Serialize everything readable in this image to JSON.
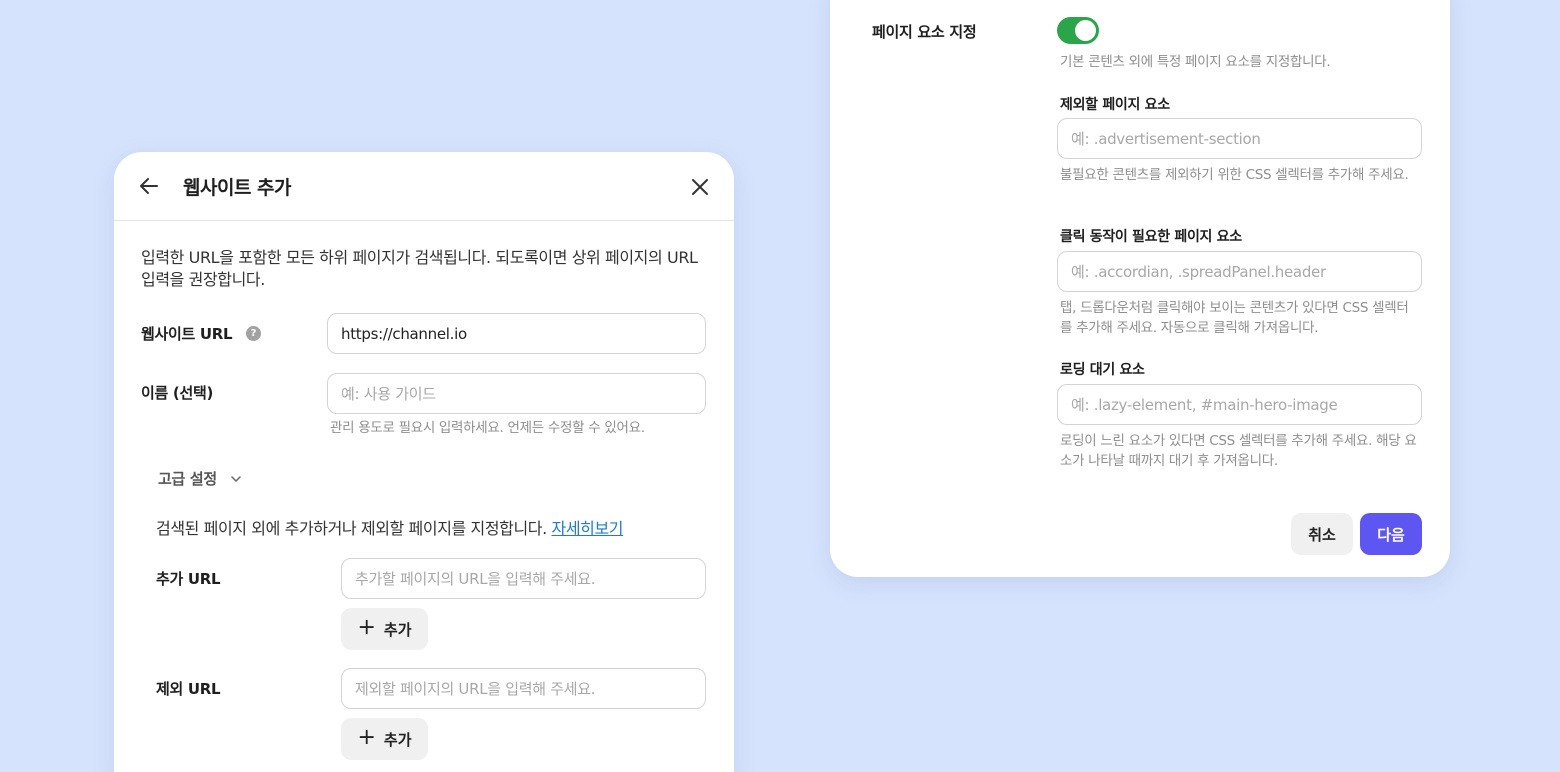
{
  "left": {
    "title": "웹사이트 추가",
    "description": "입력한 URL을 포함한 모든 하위 페이지가 검색됩니다. 되도록이면 상위 페이지의 URL 입력을 권장합니다.",
    "url_label": "웹사이트 URL",
    "help_glyph": "?",
    "url_value": "https://channel.io",
    "name_label": "이름 (선택)",
    "name_placeholder": "예: 사용 가이드",
    "name_hint": "관리 용도로 필요시 입력하세요. 언제든 수정할 수 있어요.",
    "advanced_label": "고급 설정",
    "advanced_desc": "검색된 페이지 외에 추가하거나 제외할 페이지를 지정합니다. ",
    "learn_more": "자세히보기",
    "add_url_label": "추가 URL",
    "add_url_placeholder": "추가할 페이지의 URL을 입력해 주세요.",
    "add_button": "추가",
    "exclude_url_label": "제외 URL",
    "exclude_url_placeholder": "제외할 페이지의 URL을 입력해 주세요.",
    "exclude_add_button": "추가"
  },
  "right": {
    "element_label": "페이지 요소 지정",
    "toggle_on": true,
    "toggle_desc": "기본 콘텐츠 외에 특정 페이지 요소를 지정합니다.",
    "exclude_title": "제외할 페이지 요소",
    "exclude_placeholder": "예: .advertisement-section",
    "exclude_hint": "불필요한 콘텐츠를 제외하기 위한 CSS 셀렉터를 추가해 주세요.",
    "click_title": "클릭 동작이 필요한 페이지 요소",
    "click_placeholder": "예: .accordian, .spreadPanel.header",
    "click_hint": "탭, 드롭다운처럼 클릭해야 보이는 콘텐츠가 있다면 CSS 셀렉터를 추가해 주세요. 자동으로 클릭해 가져옵니다.",
    "loading_title": "로딩 대기 요소",
    "loading_placeholder": "예: .lazy-element, #main-hero-image",
    "loading_hint": "로딩이 느린 요소가 있다면 CSS 셀렉터를 추가해 주세요. 해당 요소가 나타날 때까지 대기 후 가져옵니다.",
    "cancel": "취소",
    "next": "다음"
  },
  "colors": {
    "background": "#d6e3fd",
    "toggle_on": "#2aa54a",
    "primary": "#5e56f0",
    "link": "#1c7cd5"
  }
}
